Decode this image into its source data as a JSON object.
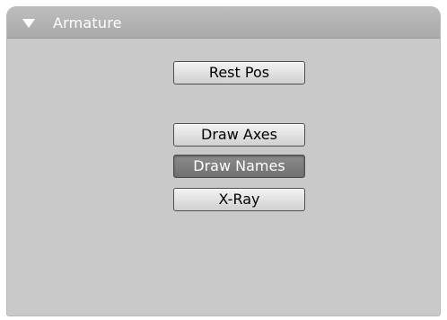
{
  "panel": {
    "title": "Armature",
    "toggle_icon": "triangle-down-icon"
  },
  "buttons": {
    "rest_pos": {
      "label": "Rest Pos",
      "active": false
    },
    "draw_axes": {
      "label": "Draw Axes",
      "active": false
    },
    "draw_names": {
      "label": "Draw Names",
      "active": true
    },
    "x_ray": {
      "label": "X-Ray",
      "active": false
    }
  },
  "colors": {
    "panel_bg": "#c9c9c9",
    "header_bg": "#b0b0b0",
    "active_button": "#7a7a7a"
  }
}
